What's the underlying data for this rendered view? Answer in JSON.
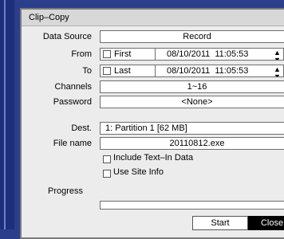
{
  "dialog": {
    "title": "Clip–Copy",
    "data_source": {
      "label": "Data Source",
      "value": "Record"
    },
    "from": {
      "label": "From",
      "checkbox_label": "First",
      "datetime": "08/10/2011  11:05:53"
    },
    "to": {
      "label": "To",
      "checkbox_label": "Last",
      "datetime": "08/10/2011  11:05:53"
    },
    "channels": {
      "label": "Channels",
      "value": "1~16"
    },
    "password": {
      "label": "Password",
      "value": "<None>"
    },
    "dest": {
      "label": "Dest.",
      "value": "1: Partition 1 [62 MB]"
    },
    "file_name": {
      "label": "File name",
      "value": "20110812.exe"
    },
    "include_text_in": {
      "label": "Include Text–In Data"
    },
    "use_site_info": {
      "label": "Use Site Info"
    },
    "progress": {
      "label": "Progress",
      "value": 0
    },
    "buttons": {
      "start": "Start",
      "close": "Close"
    }
  }
}
